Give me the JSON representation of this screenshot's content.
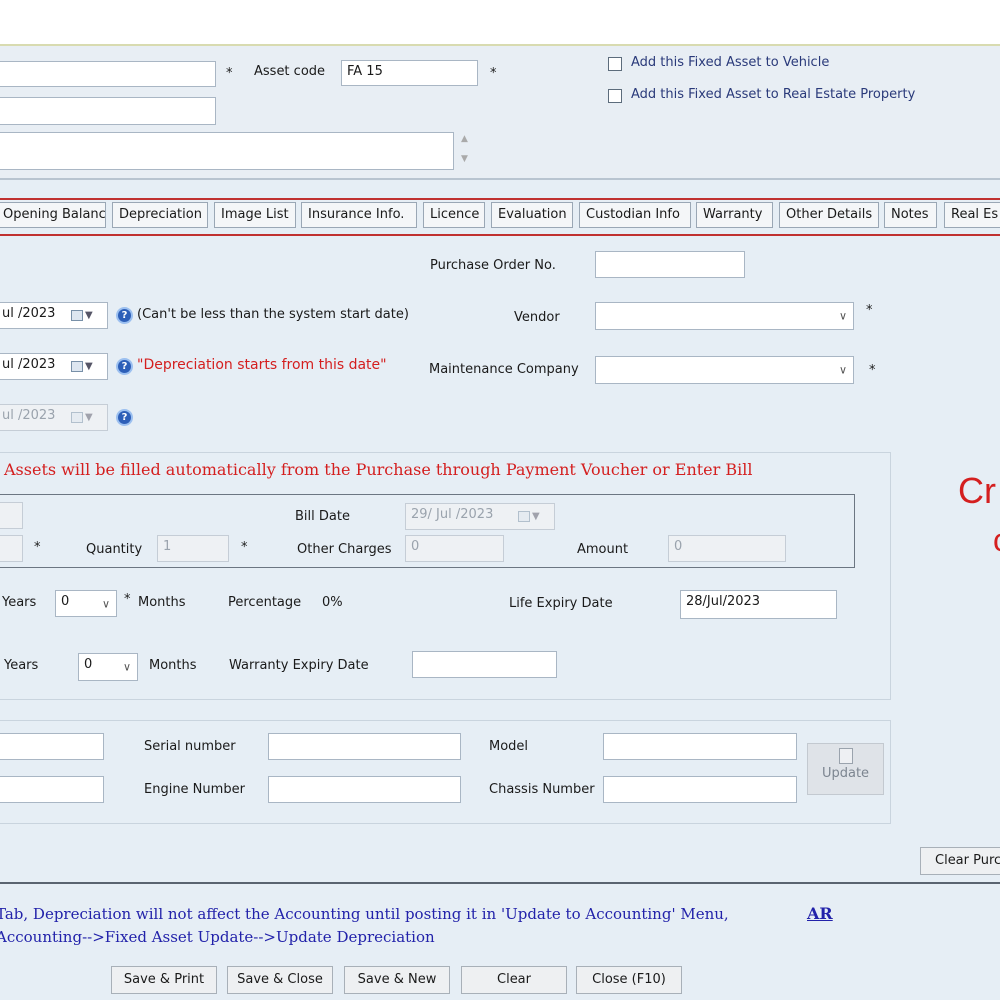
{
  "header": {
    "asset_code_label": "Asset code",
    "asset_code_value": "FA 15",
    "required": "*",
    "add_vehicle_label": "Add this Fixed Asset to Vehicle",
    "add_real_estate_label": "Add this Fixed Asset to Real Estate Property"
  },
  "tabs": [
    "Opening Balance",
    "Depreciation",
    "Image List",
    "Insurance Info.",
    "Licence",
    "Evaluation",
    "Custodian Info",
    "Warranty",
    "Other Details",
    "Notes",
    "Real Es"
  ],
  "form": {
    "date1": "ul /2023",
    "date1_note": "(Can't be less than the system start date)",
    "date2": "ul /2023",
    "date2_note": "\"Depreciation starts from this date\"",
    "date3": "ul /2023",
    "help_icon": "?",
    "purchase_order_label": "Purchase Order No.",
    "vendor_label": "Vendor",
    "maintenance_label": "Maintenance Company",
    "side_partial_1": "Cr",
    "side_partial_2": "c"
  },
  "purchase": {
    "notice": "Assets will be filled automatically from the Purchase through Payment Voucher or Enter Bill",
    "bill_date_label": "Bill Date",
    "bill_date_value": "29/ Jul /2023",
    "quantity_label": "Quantity",
    "quantity_value": "1",
    "other_charges_label": "Other Charges",
    "other_charges_value": "0",
    "amount_label": "Amount",
    "amount_value": "0",
    "years_label": "Years",
    "months_label": "Months",
    "life_years_value": "0",
    "percentage_label": "Percentage",
    "percentage_value": "0%",
    "life_expiry_label": "Life Expiry Date",
    "life_expiry_value": "28/Jul/2023",
    "warranty_years_value": "0",
    "warranty_expiry_label": "Warranty Expiry Date"
  },
  "details": {
    "serial_label": "Serial number",
    "model_label": "Model",
    "engine_label": "Engine Number",
    "chassis_label": "Chassis Number",
    "update_label": "Update"
  },
  "clear_purchase_label": "Clear Purc",
  "footer": {
    "note_line1": "Tab, Depreciation will not affect the Accounting until posting it in 'Update to Accounting' Menu,",
    "note_line2": "Accounting-->Fixed Asset Update-->Update Depreciation",
    "ar_link": "AR",
    "buttons": [
      "Save & Print",
      "Save & Close",
      "Save & New",
      "Clear",
      "Close (F10)"
    ]
  },
  "colors": {
    "background": "#e6eef5",
    "accent_red": "#d41f1f",
    "link_blue": "#2222aa"
  }
}
